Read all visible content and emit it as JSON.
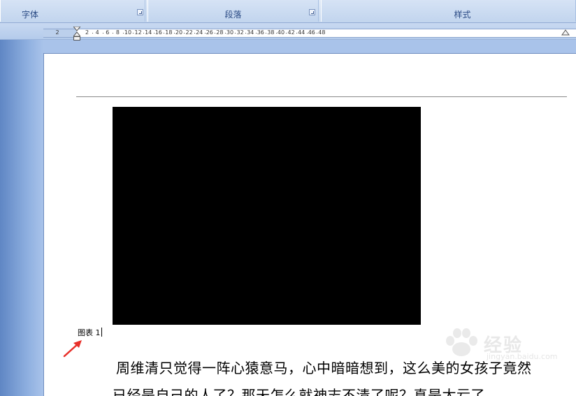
{
  "ribbon": {
    "groups": [
      {
        "label": "字体"
      },
      {
        "label": "段落"
      },
      {
        "label": "样式"
      }
    ]
  },
  "ruler": {
    "numbers": [
      "2",
      "2",
      "4",
      "6",
      "8",
      "10",
      "12",
      "14",
      "16",
      "18",
      "20",
      "22",
      "24",
      "26",
      "28",
      "30",
      "32",
      "34",
      "36",
      "38",
      "40",
      "42",
      "44",
      "46",
      "48"
    ]
  },
  "document": {
    "caption_text": "图表 1",
    "body_lines": [
      "周维清只觉得一阵心猿意马，心中暗暗想到，这么美的女孩子竟然",
      "已经是自己的人了？那天怎么就神志不清了呢？真是太亏了。"
    ]
  },
  "watermark": {
    "text": "经验",
    "url": "jingyan.baidu.com"
  },
  "colors": {
    "annotation_arrow": "#e8302a",
    "image_fill": "#000000"
  }
}
